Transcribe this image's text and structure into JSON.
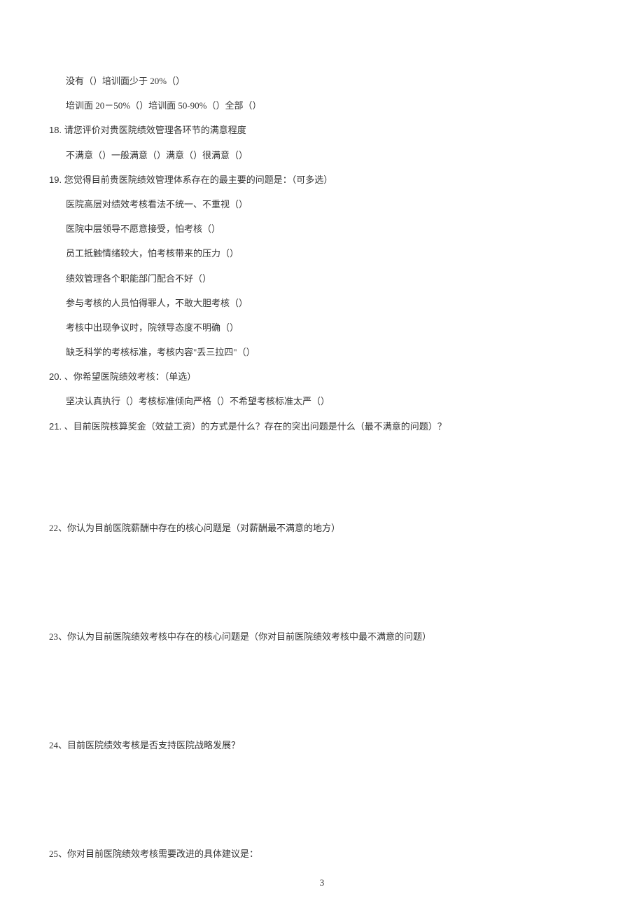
{
  "lines": {
    "l1": "没有（）培训面少于 20%（）",
    "l2": "培训面 20－50%（）培训面 50-90%（）全部（）",
    "q18_num": "18. ",
    "q18_text": "请您评价对贵医院绩效管理各环节的满意程度",
    "q18_opts": "不满意（）一般满意（）满意（）很满意（）",
    "q19_num": "19. ",
    "q19_text": "您觉得目前贵医院绩效管理体系存在的最主要的问题是：（可多选）",
    "q19_o1": "医院高层对绩效考核看法不统一、不重视（）",
    "q19_o2": "医院中层领导不愿意接受，怕考核（）",
    "q19_o3": "员工抵触情绪较大，怕考核带来的压力（）",
    "q19_o4": "绩效管理各个职能部门配合不好（）",
    "q19_o5": "参与考核的人员怕得罪人，不敢大胆考核（）",
    "q19_o6": "考核中出现争议时，院领导态度不明确（）",
    "q19_o7": "缺乏科学的考核标准，考核内容\"丢三拉四\"（）",
    "q20_num": "20. ",
    "q20_text": "、你希望医院绩效考核：（单选）",
    "q20_opts": "坚决认真执行（）考核标准倾向严格（）不希望考核标准太严（）",
    "q21_num": "21. ",
    "q21_text": "、目前医院核算奖金（效益工资）的方式是什么？存在的突出问题是什么（最不满意的问题）？",
    "q22": "22、你认为目前医院薪酬中存在的核心问题是（对薪酬最不满意的地方）",
    "q23": "23、你认为目前医院绩效考核中存在的核心问题是（你对目前医院绩效考核中最不满意的问题）",
    "q24": "24、目前医院绩效考核是否支持医院战略发展？",
    "q25": "25、你对目前医院绩效考核需要改进的具体建议是："
  },
  "pageNumber": "3"
}
